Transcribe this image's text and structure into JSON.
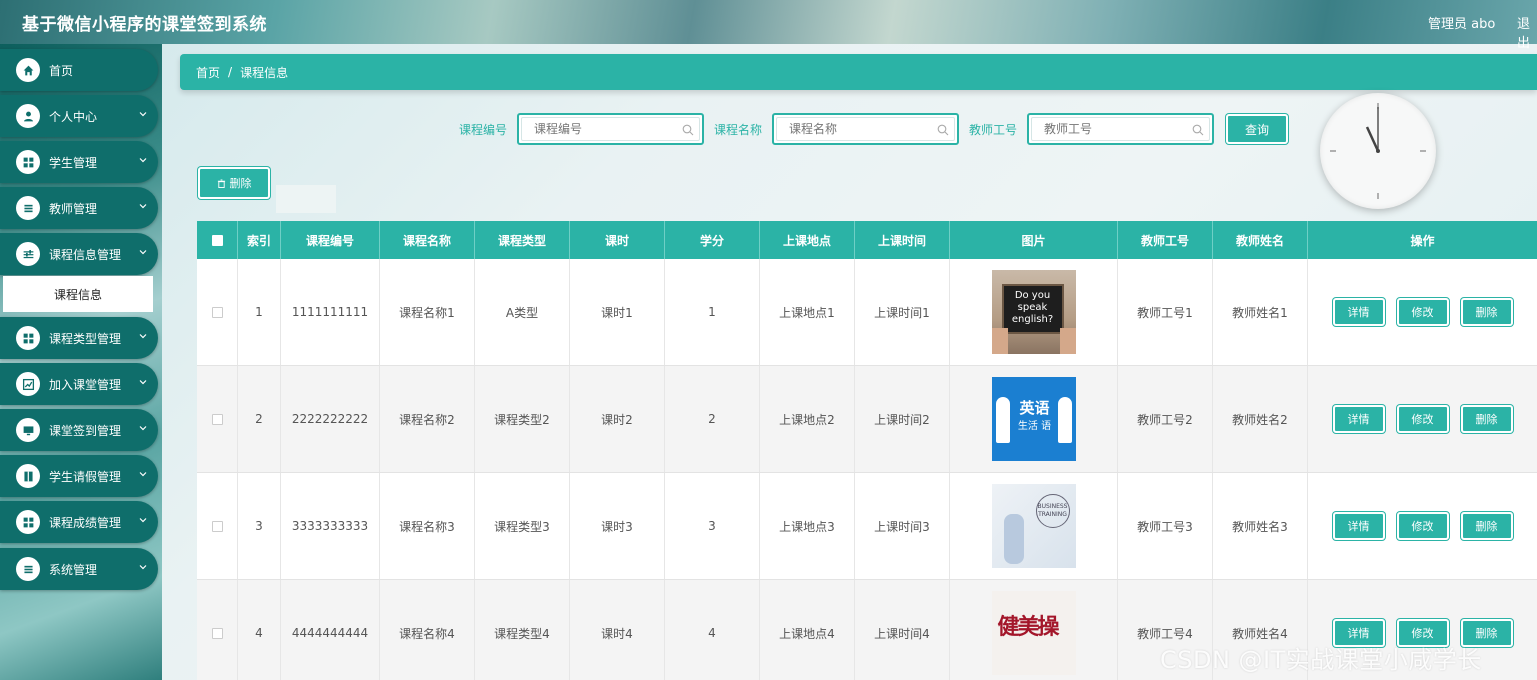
{
  "header": {
    "title": "基于微信小程序的课堂签到系统",
    "user": "管理员 abo",
    "logout": "退出"
  },
  "sidebar": {
    "items": [
      {
        "label": "首页",
        "icon": "home-icon"
      },
      {
        "label": "个人中心",
        "icon": "person-icon"
      },
      {
        "label": "学生管理",
        "icon": "grid-icon"
      },
      {
        "label": "教师管理",
        "icon": "list-icon"
      },
      {
        "label": "课程信息管理",
        "icon": "sliders-icon"
      },
      {
        "label": "课程类型管理",
        "icon": "grid-icon"
      },
      {
        "label": "加入课堂管理",
        "icon": "chart-icon"
      },
      {
        "label": "课堂签到管理",
        "icon": "monitor-icon"
      },
      {
        "label": "学生请假管理",
        "icon": "book-icon"
      },
      {
        "label": "课程成绩管理",
        "icon": "grid-icon"
      },
      {
        "label": "系统管理",
        "icon": "list-icon"
      }
    ],
    "sub_item": "课程信息"
  },
  "breadcrumb": {
    "home": "首页",
    "sep": "/",
    "current": "课程信息"
  },
  "search": {
    "course_no_label": "课程编号",
    "course_no_placeholder": "课程编号",
    "course_name_label": "课程名称",
    "course_name_placeholder": "课程名称",
    "teacher_no_label": "教师工号",
    "teacher_no_placeholder": "教师工号",
    "query": "查询"
  },
  "toolbar": {
    "delete": "删除"
  },
  "table": {
    "headers": [
      "索引",
      "课程编号",
      "课程名称",
      "课程类型",
      "课时",
      "学分",
      "上课地点",
      "上课时间",
      "图片",
      "教师工号",
      "教师姓名",
      "操作"
    ],
    "rows": [
      {
        "index": "1",
        "course_no": "1111111111",
        "name": "课程名称1",
        "type": "A类型",
        "hours": "课时1",
        "credit": "1",
        "place": "上课地点1",
        "time": "上课时间1",
        "teacher_no": "教师工号1",
        "teacher_name": "教师姓名1"
      },
      {
        "index": "2",
        "course_no": "2222222222",
        "name": "课程名称2",
        "type": "课程类型2",
        "hours": "课时2",
        "credit": "2",
        "place": "上课地点2",
        "time": "上课时间2",
        "teacher_no": "教师工号2",
        "teacher_name": "教师姓名2"
      },
      {
        "index": "3",
        "course_no": "3333333333",
        "name": "课程名称3",
        "type": "课程类型3",
        "hours": "课时3",
        "credit": "3",
        "place": "上课地点3",
        "time": "上课时间3",
        "teacher_no": "教师工号3",
        "teacher_name": "教师姓名3"
      },
      {
        "index": "4",
        "course_no": "4444444444",
        "name": "课程名称4",
        "type": "课程类型4",
        "hours": "课时4",
        "credit": "4",
        "place": "上课地点4",
        "time": "上课时间4",
        "teacher_no": "教师工号4",
        "teacher_name": "教师姓名4"
      }
    ],
    "actions": {
      "detail": "详情",
      "edit": "修改",
      "delete": "删除"
    }
  },
  "images": {
    "img1": "Do you speak english?",
    "img2_top": "英语",
    "img2_bottom": "生活 语",
    "img3": "BUSINESS TRAINING",
    "img4": "健美操"
  },
  "watermark": "CSDN @IT实战课堂小咸学长",
  "colors": {
    "accent": "#2bb3a6",
    "nav": "#0f6e6b"
  }
}
